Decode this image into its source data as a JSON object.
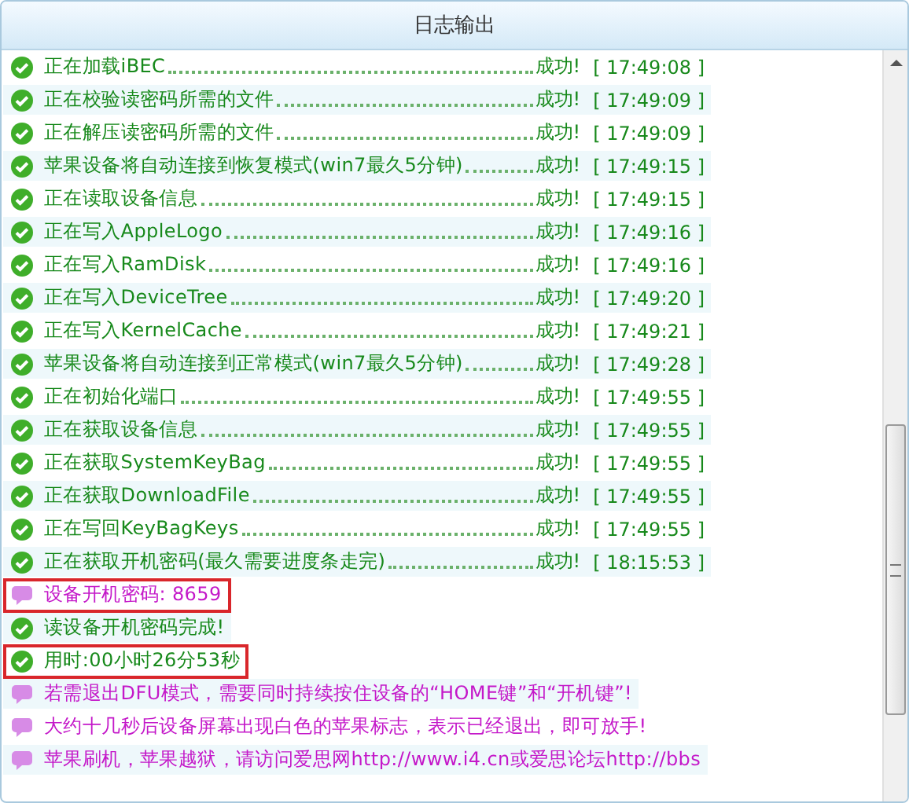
{
  "panel": {
    "title": "日志输出"
  },
  "log": [
    {
      "kind": "success",
      "text": "正在加载iBEC",
      "status": "成功!",
      "time": "[ 17:49:08 ]",
      "highlighted": false
    },
    {
      "kind": "success",
      "text": "正在校验读密码所需的文件",
      "status": "成功!",
      "time": "[ 17:49:09 ]",
      "highlighted": false
    },
    {
      "kind": "success",
      "text": "正在解压读密码所需的文件",
      "status": "成功!",
      "time": "[ 17:49:09 ]",
      "highlighted": false
    },
    {
      "kind": "success",
      "text": "苹果设备将自动连接到恢复模式(win7最久5分钟)",
      "status": "成功!",
      "time": "[ 17:49:15 ]",
      "highlighted": false
    },
    {
      "kind": "success",
      "text": "正在读取设备信息",
      "status": "成功!",
      "time": "[ 17:49:15 ]",
      "highlighted": false
    },
    {
      "kind": "success",
      "text": "正在写入AppleLogo",
      "status": "成功!",
      "time": "[ 17:49:16 ]",
      "highlighted": false
    },
    {
      "kind": "success",
      "text": "正在写入RamDisk",
      "status": "成功!",
      "time": "[ 17:49:16 ]",
      "highlighted": false
    },
    {
      "kind": "success",
      "text": "正在写入DeviceTree",
      "status": "成功!",
      "time": "[ 17:49:20 ]",
      "highlighted": false
    },
    {
      "kind": "success",
      "text": "正在写入KernelCache",
      "status": "成功!",
      "time": "[ 17:49:21 ]",
      "highlighted": false
    },
    {
      "kind": "success",
      "text": "苹果设备将自动连接到正常模式(win7最久5分钟)",
      "status": "成功!",
      "time": "[ 17:49:28 ]",
      "highlighted": false
    },
    {
      "kind": "success",
      "text": "正在初始化端口",
      "status": "成功!",
      "time": "[ 17:49:55 ]",
      "highlighted": false
    },
    {
      "kind": "success",
      "text": "正在获取设备信息",
      "status": "成功!",
      "time": "[ 17:49:55 ]",
      "highlighted": false
    },
    {
      "kind": "success",
      "text": "正在获取SystemKeyBag",
      "status": "成功!",
      "time": "[ 17:49:55 ]",
      "highlighted": false
    },
    {
      "kind": "success",
      "text": "正在获取DownloadFile",
      "status": "成功!",
      "time": "[ 17:49:55 ]",
      "highlighted": false
    },
    {
      "kind": "success",
      "text": "正在写回KeyBagKeys",
      "status": "成功!",
      "time": "[ 17:49:55 ]",
      "highlighted": false
    },
    {
      "kind": "success",
      "text": "正在获取开机密码(最久需要进度条走完)",
      "status": "成功!",
      "time": "[ 18:15:53 ]",
      "highlighted": false
    },
    {
      "kind": "info",
      "text": "设备开机密码: 8659",
      "highlighted": true
    },
    {
      "kind": "success",
      "text": "读设备开机密码完成!",
      "highlighted": false
    },
    {
      "kind": "success",
      "text": "用时:00小时26分53秒",
      "highlighted": true
    },
    {
      "kind": "info",
      "text": "若需退出DFU模式，需要同时持续按住设备的“HOME键”和“开机键”!",
      "highlighted": false
    },
    {
      "kind": "info",
      "text": "大约十几秒后设备屏幕出现白色的苹果标志，表示已经退出，即可放手!",
      "highlighted": false
    },
    {
      "kind": "info",
      "text": "苹果刷机，苹果越狱，请访问爱思网http://www.i4.cn或爱思论坛http://bbs",
      "highlighted": false
    }
  ]
}
